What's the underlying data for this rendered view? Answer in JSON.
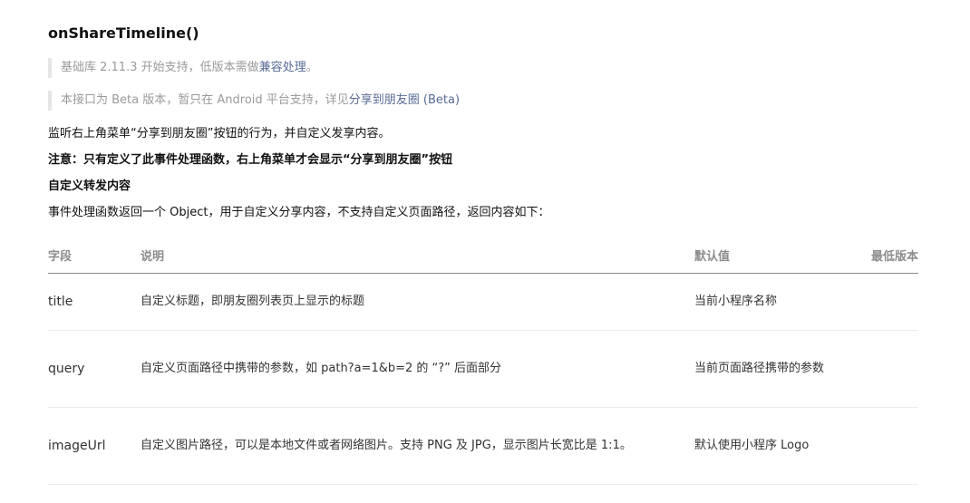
{
  "heading": "onShareTimeline()",
  "notes": [
    {
      "prefix": "基础库 2.11.3 开始支持，低版本需做",
      "link": "兼容处理",
      "suffix": "。"
    },
    {
      "prefix": "本接口为 Beta 版本，暂只在 Android 平台支持，详见",
      "link": "分享到朋友圈 (Beta)",
      "suffix": ""
    }
  ],
  "paragraphs": {
    "intro": "监听右上角菜单“分享到朋友圈”按钮的行为，并自定义发享内容。",
    "warning": "注意：只有定义了此事件处理函数，右上角菜单才会显示“分享到朋友圈”按钮",
    "subheading": "自定义转发内容",
    "desc": "事件处理函数返回一个 Object，用于自定义分享内容，不支持自定义页面路径，返回内容如下："
  },
  "table": {
    "headers": {
      "field": "字段",
      "desc": "说明",
      "default": "默认值",
      "min": "最低版本"
    },
    "rows": [
      {
        "field": "title",
        "desc": "自定义标题，即朋友圈列表页上显示的标题",
        "default": "当前小程序名称",
        "min": ""
      },
      {
        "field": "query",
        "desc": "自定义页面路径中携带的参数，如 path?a=1&b=2 的 “?” 后面部分",
        "default": "当前页面路径携带的参数",
        "min": ""
      },
      {
        "field": "imageUrl",
        "desc": "自定义图片路径，可以是本地文件或者网络图片。支持 PNG 及 JPG，显示图片长宽比是 1:1。",
        "default": "默认使用小程序 Logo",
        "min": ""
      }
    ]
  },
  "colors": {
    "link": "#576b95",
    "note_text": "#9a9a9a",
    "note_border": "#e6e6e6",
    "header_text": "#8c8c8c"
  }
}
